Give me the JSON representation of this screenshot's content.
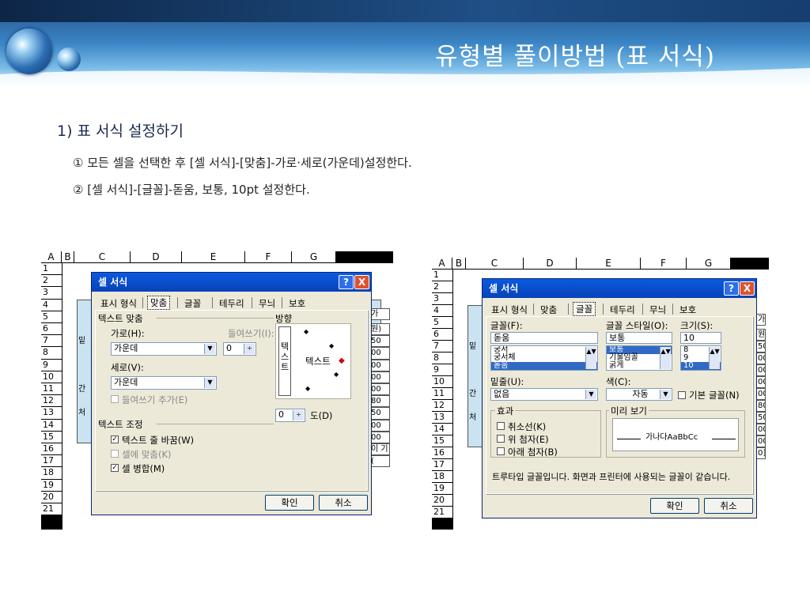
{
  "slide": {
    "title": "유형별 풀이방법 (표 서식)",
    "heading": "1) 표 서식 설정하기",
    "steps": [
      "① 모든 셀을 선택한 후 [셀 서식]-[맞춤]-가로·세로(가운데)설정한다.",
      "② [셀 서식]-[글꼴]-돋움, 보통, 10pt 설정한다."
    ]
  },
  "sheet": {
    "columns": [
      "A",
      "B",
      "C",
      "D",
      "E",
      "F",
      "G"
    ],
    "rows": [
      "1",
      "2",
      "3",
      "4",
      "5",
      "6",
      "7",
      "8",
      "9",
      "10",
      "11",
      "12",
      "13",
      "14",
      "15",
      "16",
      "17",
      "18",
      "19",
      "20",
      "21"
    ],
    "right_cells_left": [
      "가",
      "원)",
      "50",
      "00",
      "00",
      "00",
      "00",
      "80",
      "50",
      "00",
      "00",
      "이 기",
      "("
    ],
    "right_cells_right": [
      "가",
      "원",
      "50",
      "00",
      "00",
      "00",
      "00",
      "80",
      "50",
      "00",
      "00",
      "0]"
    ],
    "left_marks_left": [
      "밑",
      "간",
      "처"
    ],
    "left_marks_right": [
      "밑",
      "간",
      "처"
    ]
  },
  "dialog_common": {
    "title": "셀 서식",
    "help_glyph": "?",
    "close_glyph": "X",
    "tabs": [
      "표시 형식",
      "맞춤",
      "글꼴",
      "테두리",
      "무늬",
      "보호"
    ],
    "ok": "확인",
    "cancel": "취소"
  },
  "align_dialog": {
    "active_tab": "맞춤",
    "text_align_group": "텍스트 맞춤",
    "horizontal_label": "가로(H):",
    "horizontal_value": "가운데",
    "indent_label": "들여쓰기(I):",
    "indent_value": "0",
    "vertical_label": "세로(V):",
    "vertical_value": "가운데",
    "add_indent": "들여쓰기 추가(E)",
    "orientation_label": "방향",
    "vertical_text": "텍\n스\n트",
    "orientation_text": "텍스트",
    "degrees_value": "0",
    "degrees_label": "도(D)",
    "text_control_group": "텍스트 조정",
    "wrap_text": "텍스트 줄 바꿈(W)",
    "shrink_fit": "셀에 맞춤(K)",
    "merge_cells": "셀 병합(M)"
  },
  "font_dialog": {
    "active_tab": "글꼴",
    "font_label": "글꼴(F):",
    "font_value": "돋움",
    "font_list": [
      "궁서",
      "궁서체",
      "돋움"
    ],
    "style_label": "글꼴 스타일(O):",
    "style_value": "보통",
    "style_list": [
      "보통",
      "기울임꼴",
      "굵게"
    ],
    "size_label": "크기(S):",
    "size_value": "10",
    "size_list": [
      "8",
      "9",
      "10"
    ],
    "underline_label": "밑줄(U):",
    "underline_value": "없음",
    "color_label": "색(C):",
    "color_value": "자동",
    "normal_font": "기본 글꼴(N)",
    "effects_group": "효과",
    "strike": "취소선(K)",
    "superscript": "위 첨자(E)",
    "subscript": "아래 첨자(B)",
    "preview_group": "미리 보기",
    "preview_text": "가나다AaBbCc",
    "note": "트루타입 글꼴입니다. 화면과 프린터에 사용되는 글꼴이 같습니다."
  }
}
